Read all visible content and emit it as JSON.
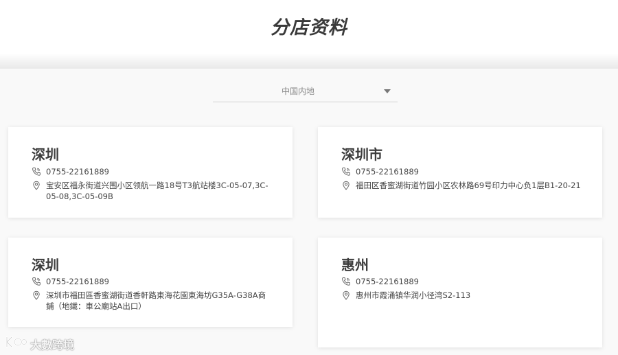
{
  "header": {
    "title": "分店资料"
  },
  "region_select": {
    "value": "中国内地"
  },
  "stores": [
    {
      "city": "深圳",
      "phone": "0755-22161889",
      "address": "宝安区福永街道兴围小区领航一路18号T3航站楼3C-05-07,3C-05-08,3C-05-09B"
    },
    {
      "city": "深圳市",
      "phone": "0755-22161889",
      "address": "福田区香蜜湖街道竹园小区农林路69号印力中心负1层B1-20-21"
    },
    {
      "city": "深圳",
      "phone": "0755-22161889",
      "address": "深圳市福田區香蜜湖街道香軒路東海花園東海坊G35A-G38A商鋪（地鐵：車公廟站A出口）"
    },
    {
      "city": "惠州",
      "phone": "0755-22161889",
      "address": "惠州市霞涌镇华润小径湾S2-113"
    }
  ],
  "watermark": {
    "text": "大數跨境"
  },
  "icons": {
    "phone": "phone-icon",
    "location": "location-pin-icon",
    "caret": "caret-down-icon"
  }
}
